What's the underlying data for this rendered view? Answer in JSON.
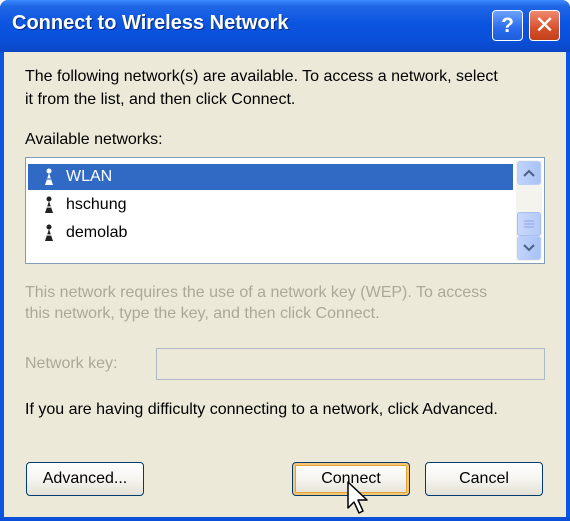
{
  "window": {
    "title": "Connect to Wireless Network",
    "help_glyph": "?",
    "close_glyph": "✕"
  },
  "intro_text_line1": "The following network(s) are available. To access a network, select",
  "intro_text_line2": "it from the list, and then click Connect.",
  "available_label": "Available networks:",
  "networks": [
    {
      "name": "WLAN",
      "selected": true,
      "icon": "antenna-icon"
    },
    {
      "name": "hschung",
      "selected": false,
      "icon": "antenna-icon"
    },
    {
      "name": "demolab",
      "selected": false,
      "icon": "antenna-icon"
    }
  ],
  "wep_text_line1": "This network requires the use of a network key (WEP). To access",
  "wep_text_line2": "this network, type the key, and then click Connect.",
  "key_label": "Network key:",
  "key_value": "",
  "advanced_text": "If you are having difficulty connecting to a network, click Advanced.",
  "buttons": {
    "advanced": "Advanced...",
    "connect": "Connect",
    "cancel": "Cancel"
  },
  "colors": {
    "titlebar": "#0a55e2",
    "selection": "#316ac5",
    "dialog_bg": "#ece9d8",
    "disabled_text": "#aca899"
  }
}
